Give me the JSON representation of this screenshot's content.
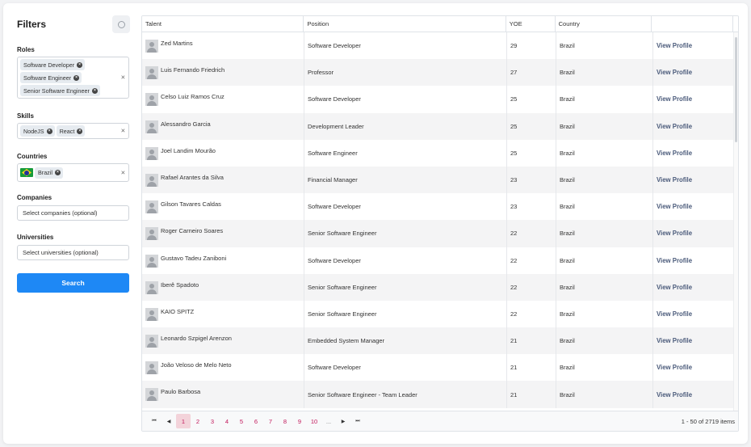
{
  "filters": {
    "title": "Filters",
    "reset_icon": "refresh-icon",
    "roles": {
      "label": "Roles",
      "chips": [
        "Software Developer",
        "Software Engineer",
        "Senior Software Engineer"
      ]
    },
    "skills": {
      "label": "Skills",
      "chips": [
        "NodeJS",
        "React"
      ]
    },
    "countries": {
      "label": "Countries",
      "chips": [
        "Brazil"
      ]
    },
    "companies": {
      "label": "Companies",
      "placeholder": "Select companies (optional)"
    },
    "universities": {
      "label": "Universities",
      "placeholder": "Select universities (optional)"
    },
    "search_label": "Search",
    "clear_symbol": "×",
    "chip_remove_symbol": "×"
  },
  "table": {
    "columns": [
      "Talent",
      "Position",
      "YOE",
      "Country",
      ""
    ],
    "link_label": "View Profile",
    "rows": [
      {
        "talent": "Zed Martins",
        "position": "Software Developer",
        "yoe": "29",
        "country": "Brazil"
      },
      {
        "talent": "Luis Fernando Friedrich",
        "position": "Professor",
        "yoe": "27",
        "country": "Brazil"
      },
      {
        "talent": "Celso Luiz Ramos Cruz",
        "position": "Software Developer",
        "yoe": "25",
        "country": "Brazil"
      },
      {
        "talent": "Alessandro Garcia",
        "position": "Development Leader",
        "yoe": "25",
        "country": "Brazil"
      },
      {
        "talent": "Joel Landim Mourão",
        "position": "Software Engineer",
        "yoe": "25",
        "country": "Brazil"
      },
      {
        "talent": "Rafael Arantes da Silva",
        "position": "Financial Manager",
        "yoe": "23",
        "country": "Brazil"
      },
      {
        "talent": "Gilson Tavares Caldas",
        "position": "Software Developer",
        "yoe": "23",
        "country": "Brazil"
      },
      {
        "talent": "Roger Carneiro Soares",
        "position": "Senior Software Engineer",
        "yoe": "22",
        "country": "Brazil"
      },
      {
        "talent": "Gustavo Tadeu Zaniboni",
        "position": "Software Developer",
        "yoe": "22",
        "country": "Brazil"
      },
      {
        "talent": "Iberê Spadoto",
        "position": "Senior Software Engineer",
        "yoe": "22",
        "country": "Brazil"
      },
      {
        "talent": "KAIO SPITZ",
        "position": "Senior Software Engineer",
        "yoe": "22",
        "country": "Brazil"
      },
      {
        "talent": "Leonardo Szpigel Arenzon",
        "position": "Embedded System Manager",
        "yoe": "21",
        "country": "Brazil"
      },
      {
        "talent": "João Veloso de Melo Neto",
        "position": "Software Developer",
        "yoe": "21",
        "country": "Brazil"
      },
      {
        "talent": "Paulo Barbosa",
        "position": "Senior Software Engineer - Team Leader",
        "yoe": "21",
        "country": "Brazil"
      }
    ]
  },
  "pagination": {
    "pages": [
      "1",
      "2",
      "3",
      "4",
      "5",
      "6",
      "7",
      "8",
      "9",
      "10",
      "..."
    ],
    "active_page": "1",
    "first_symbol": "⏮",
    "prev_symbol": "◀",
    "next_symbol": "▶",
    "last_symbol": "⏭",
    "info": "1 - 50 of 2719 items"
  }
}
